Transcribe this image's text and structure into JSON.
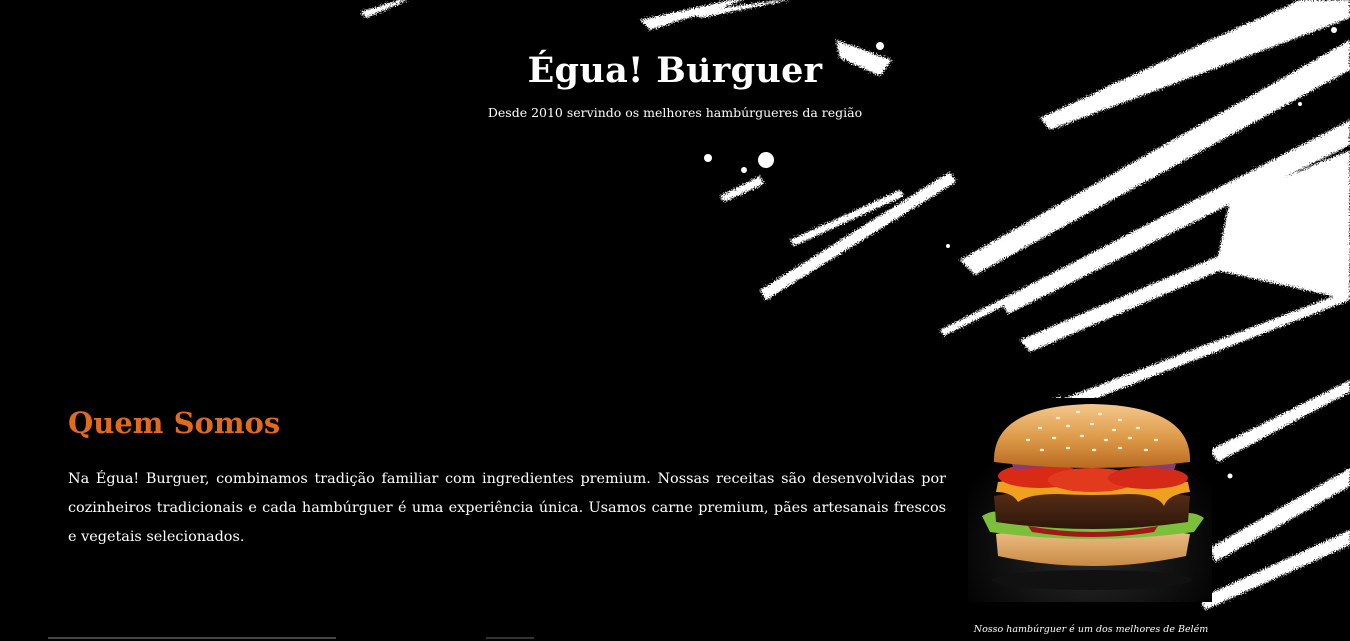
{
  "header": {
    "title": "Égua! Burguer",
    "tagline": "Desde 2010 servindo os melhores hambúrgueres da região"
  },
  "about": {
    "heading": "Quem Somos",
    "text": "Na Égua! Burguer, combinamos tradição familiar com ingredientes premium. Nossas receitas são desenvolvidas por cozinheiros tradicionais e cada hambúrguer é uma experiência única. Usamos carne premium, pães artesanais frescos e vegetais selecionados."
  },
  "figure": {
    "image": "burger-photo",
    "caption": "Nosso hambúrguer é um dos melhores de Belém"
  },
  "colors": {
    "background": "#000000",
    "accent": "#e06a1e",
    "text": "#ffffff"
  }
}
